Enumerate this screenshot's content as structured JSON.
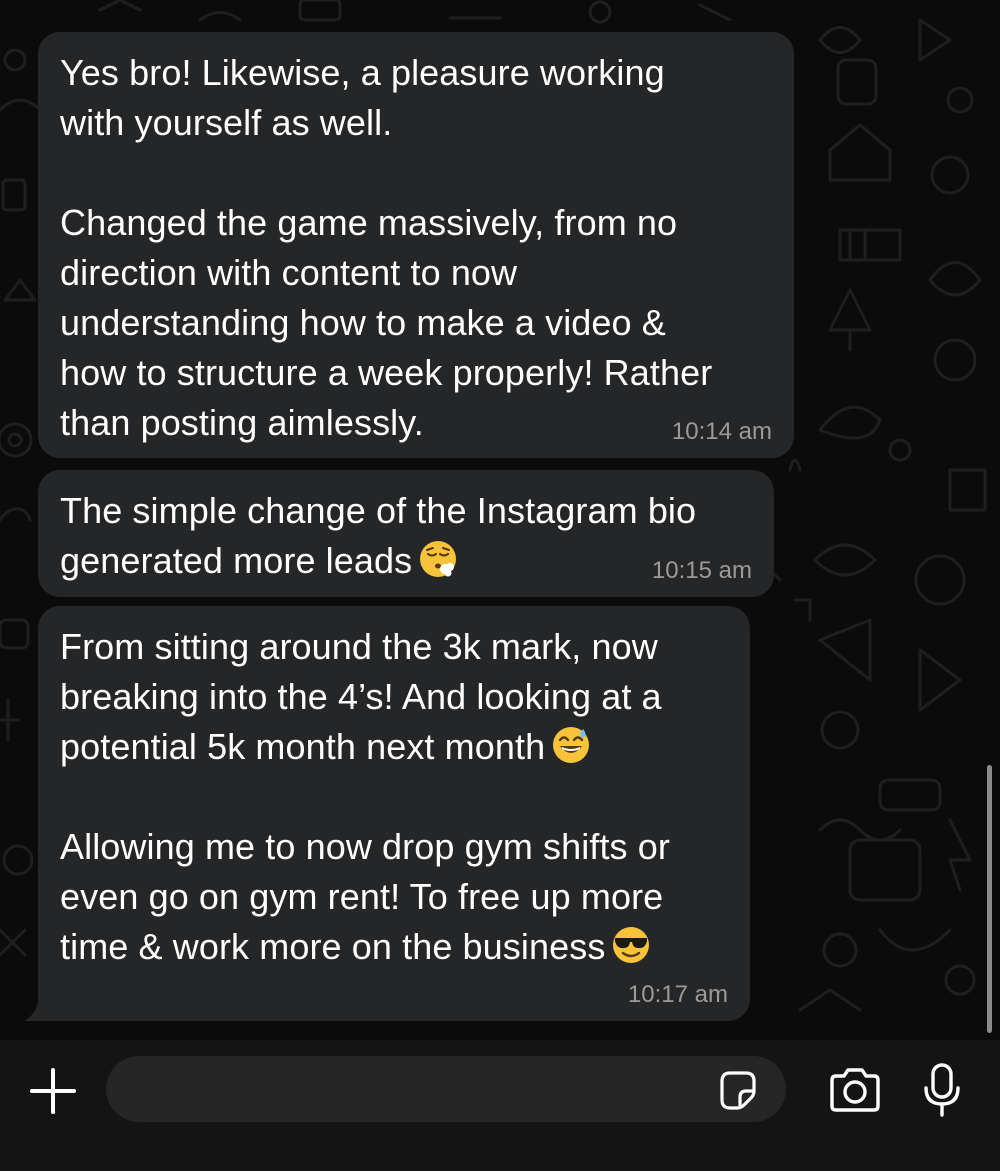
{
  "messages": [
    {
      "text": "Yes bro! Likewise, a pleasure working\nwith yourself as well.\n\nChanged the game massively, from no\ndirection with content to now\nunderstanding how to make a video &\nhow to structure a week properly! Rather\nthan posting aimlessly.",
      "time": "10:14 am"
    },
    {
      "text": "The simple change of the Instagram bio\ngenerated more leads",
      "emoji": "face-exhaling-emoji",
      "time": "10:15 am"
    },
    {
      "text": "From sitting around the 3k mark, now\nbreaking into the 4’s! And looking at a\npotential 5k month next month",
      "emoji": "grinning-face-with-sweat-emoji",
      "text2": "\n\nAllowing me to now drop gym shifts or\neven go on gym rent! To free up more\ntime & work more on the business",
      "emoji2": "smiling-face-with-sunglasses-emoji",
      "time": "10:17 am"
    }
  ],
  "input_bar": {
    "placeholder": "",
    "icons": [
      "plus-icon",
      "sticker-icon",
      "camera-icon",
      "microphone-icon"
    ]
  },
  "colors": {
    "background": "#0b0b0b",
    "bubble": "#252627",
    "text": "#ffffff",
    "timestamp": "#9a9a9a",
    "input_bar": "#141414",
    "input_field": "#262627"
  }
}
